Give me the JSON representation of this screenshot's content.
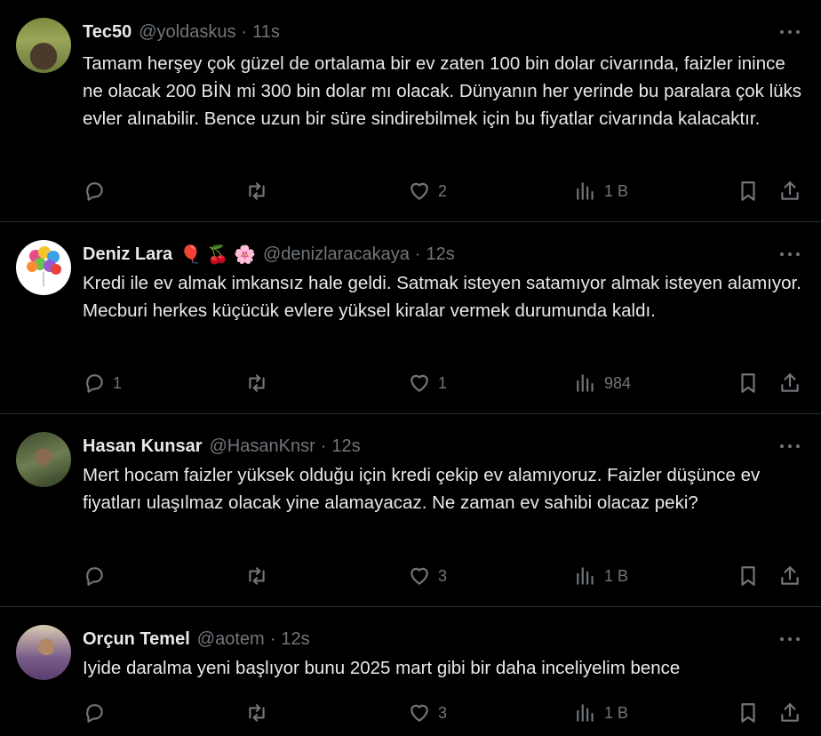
{
  "tweets": [
    {
      "name": "Tec50",
      "emoji": "",
      "handle": "@yoldaskus",
      "time": "11s",
      "text": "Tamam herşey çok güzel de ortalama bir ev zaten 100 bin dolar civarında, faizler inince ne olacak 200 BİN mi 300 bin dolar mı olacak. Dünyanın her yerinde bu paralara çok lüks evler alınabilir. Bence uzun bir süre sindirebilmek için bu fiyatlar civarında kalacaktır.",
      "replies": "",
      "retweets": "",
      "likes": "2",
      "views": "1 B"
    },
    {
      "name": "Deniz Lara",
      "emoji": "🎈 🍒 🌸",
      "handle": "@denizlaracakaya",
      "time": "12s",
      "text": "Kredi ile ev almak imkansız hale geldi. Satmak isteyen satamıyor almak isteyen alamıyor. Mecburi herkes küçücük evlere yüksel kiralar vermek durumunda kaldı.",
      "replies": "1",
      "retweets": "",
      "likes": "1",
      "views": "984"
    },
    {
      "name": "Hasan Kunsar",
      "emoji": "",
      "handle": "@HasanKnsr",
      "time": "12s",
      "text": "Mert hocam faizler yüksek olduğu için kredi çekip ev alamıyoruz. Faizler düşünce ev fiyatları ulaşılmaz olacak yine alamayacaz. Ne zaman ev sahibi olacaz peki?",
      "replies": "",
      "retweets": "",
      "likes": "3",
      "views": "1 B"
    },
    {
      "name": "Orçun Temel",
      "emoji": "",
      "handle": "@aotem",
      "time": "12s",
      "text": "Iyide daralma yeni başlıyor bunu 2025 mart gibi bir daha inceliyelim bence",
      "replies": "",
      "retweets": "",
      "likes": "3",
      "views": "1 B"
    }
  ],
  "separator": "·",
  "icons": {
    "reply": "reply-icon",
    "retweet": "retweet-icon",
    "like": "heart-icon",
    "views": "views-icon",
    "bookmark": "bookmark-icon",
    "share": "share-icon",
    "more": "more-icon"
  },
  "colors": {
    "background": "#000000",
    "text": "#e7e9ea",
    "muted": "#71767b",
    "border": "#2f3336"
  }
}
